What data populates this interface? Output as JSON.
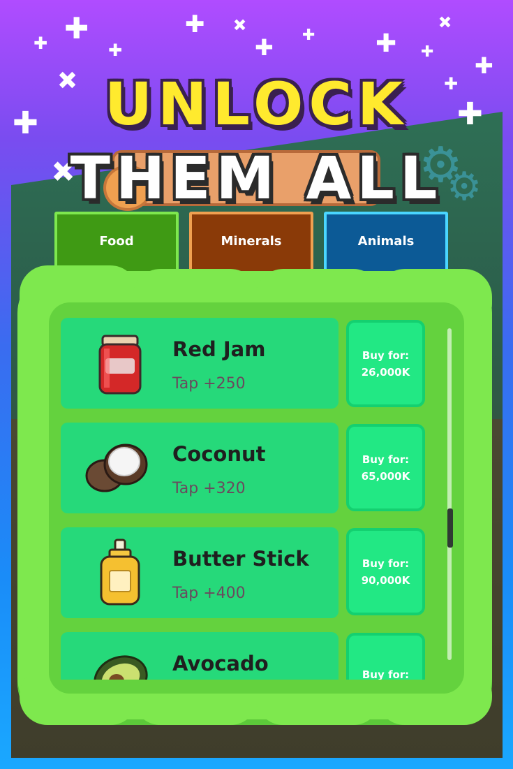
{
  "headline": {
    "line1": "UNLOCK",
    "line2": "THEM ALL"
  },
  "tabs": [
    {
      "label": "Food"
    },
    {
      "label": "Minerals"
    },
    {
      "label": "Animals"
    }
  ],
  "items": [
    {
      "name": "Red Jam",
      "bonus": "Tap +250",
      "buy_line1": "Buy for:",
      "buy_price": "26,000K",
      "icon": "jam-jar-icon"
    },
    {
      "name": "Coconut",
      "bonus": "Tap +320",
      "buy_line1": "Buy for:",
      "buy_price": "65,000K",
      "icon": "coconut-icon"
    },
    {
      "name": "Butter Stick",
      "bonus": "Tap +400",
      "buy_line1": "Buy for:",
      "buy_price": "90,000K",
      "icon": "butter-bottle-icon"
    },
    {
      "name": "Avocado",
      "bonus": "",
      "buy_line1": "Buy for:",
      "buy_price": "",
      "icon": "avocado-icon"
    }
  ],
  "colors": {
    "panel_green": "#7ee84e",
    "card_green": "#26d97a",
    "headline_yellow": "#ffea2e"
  }
}
